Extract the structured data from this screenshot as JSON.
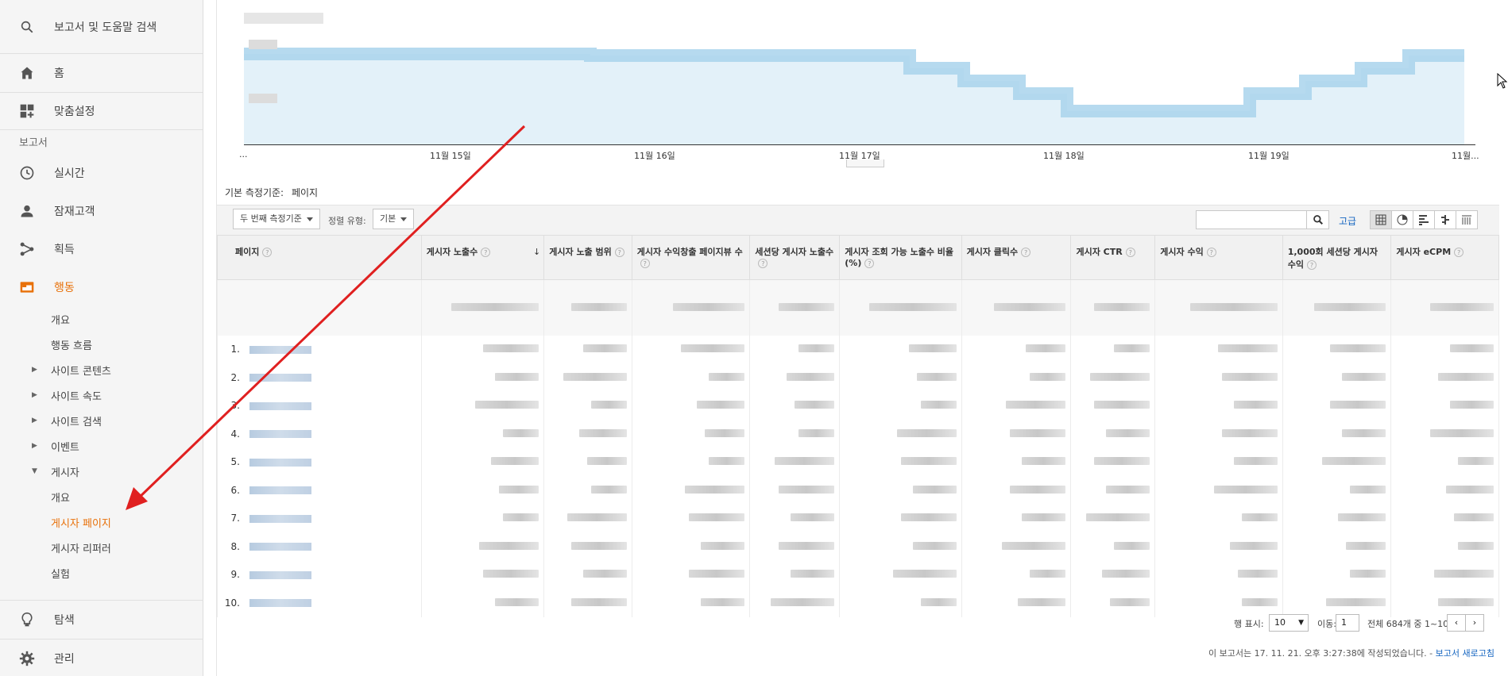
{
  "sidebar": {
    "search_label": "보고서 및 도움말 검색",
    "home": "홈",
    "customization": "맞춤설정",
    "reports_section": "보고서",
    "realtime": "실시간",
    "audience": "잠재고객",
    "acquisition": "획득",
    "behavior": "행동",
    "behavior_items": [
      "개요",
      "행동 흐름",
      "사이트 콘텐츠",
      "사이트 속도",
      "사이트 검색",
      "이벤트",
      "게시자"
    ],
    "publisher_items": [
      "개요",
      "게시자 페이지",
      "게시자 리퍼러",
      "실험"
    ],
    "explore": "탐색",
    "admin": "관리"
  },
  "chart": {
    "x_ticks": [
      "...",
      "11월 15일",
      "11월 16일",
      "11월 17일",
      "11월 18일",
      "11월 19일",
      "11월..."
    ]
  },
  "primary_dimension": {
    "label": "기본 측정기준:",
    "value": "페이지"
  },
  "toolbar": {
    "secondary_dim": "두 번째 측정기준",
    "sort_label": "정렬 유형:",
    "sort_value": "기본",
    "advanced": "고급"
  },
  "table": {
    "columns": [
      "페이지",
      "게시자 노출수",
      "게시자 노출 범위",
      "게시자 수익창출 페이지뷰 수",
      "세션당 게시자 노출수",
      "게시자 조회 가능 노출수 비율(%)",
      "게시자 클릭수",
      "게시자 CTR",
      "게시자 수익",
      "1,000회 세션당 게시자 수익",
      "게시자 eCPM"
    ],
    "row_numbers": [
      "1.",
      "2.",
      "3.",
      "4.",
      "5.",
      "6.",
      "7.",
      "8.",
      "9.",
      "10."
    ]
  },
  "pager": {
    "rows_label": "행 표시:",
    "rows_value": "10",
    "goto_label": "이동:",
    "goto_value": "1",
    "range_text": "전체 684개 중 1~10"
  },
  "footer": {
    "note": "이 보고서는 17. 11. 21. 오후 3:27:38에 작성되었습니다. -",
    "refresh": "보고서 새로고침"
  },
  "colors": {
    "accent": "#e8710a",
    "arrow": "#e02020",
    "link": "#1565c0",
    "chart_fill": "#e3f1f9",
    "chart_line": "#a9d4ec"
  }
}
